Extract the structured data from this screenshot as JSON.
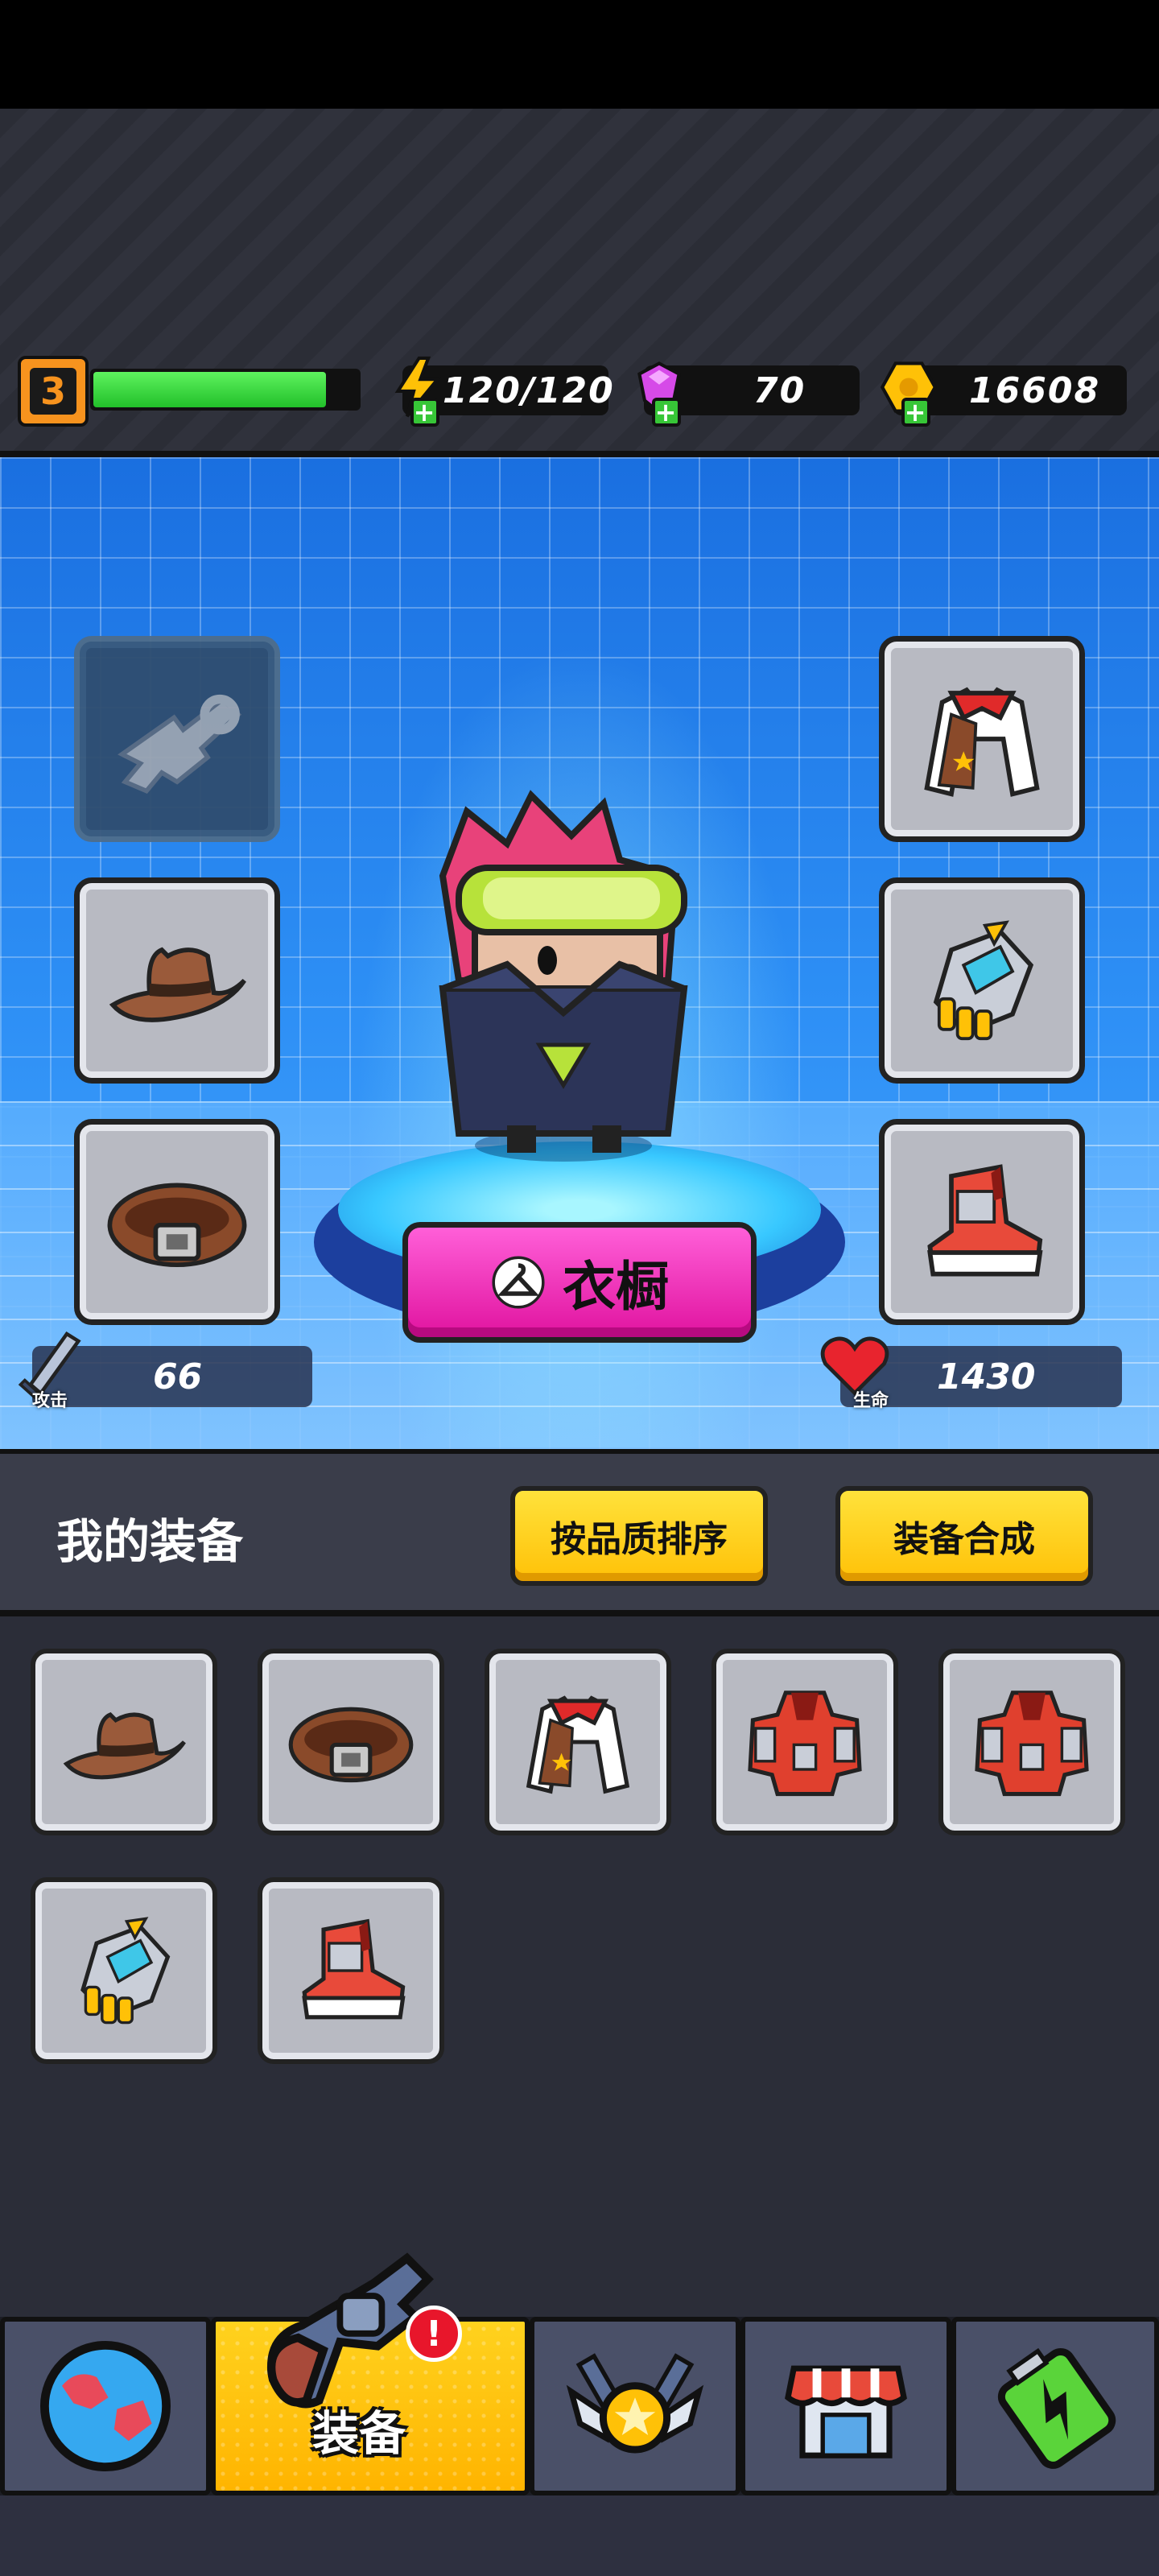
{
  "hud": {
    "level": "3",
    "xp_progress": 0.88,
    "energy": "120/120",
    "gems": "70",
    "coins": "16608"
  },
  "character_stage": {
    "wardrobe_label": "衣橱",
    "attack_label": "攻击",
    "attack_value": "66",
    "health_label": "生命",
    "health_value": "1430",
    "equipped": {
      "weapon": "gun-icon",
      "hat": "cowboy-hat-icon",
      "belt": "belt-icon",
      "armor": "vest-icon",
      "gloves": "gauntlet-icon",
      "shoes": "sneaker-icon"
    }
  },
  "equipment_section": {
    "title": "我的装备",
    "sort_button": "按品质排序",
    "merge_button": "装备合成"
  },
  "inventory": [
    {
      "item": "cowboy-hat-icon"
    },
    {
      "item": "belt-icon"
    },
    {
      "item": "vest-icon"
    },
    {
      "item": "red-armor-icon"
    },
    {
      "item": "red-armor-icon"
    },
    {
      "item": "gauntlet-icon"
    },
    {
      "item": "sneaker-icon"
    }
  ],
  "nav": {
    "items": [
      {
        "name": "world-icon"
      },
      {
        "name": "equipment",
        "label": "装备",
        "active": true,
        "alert": "!"
      },
      {
        "name": "talent-badge-icon"
      },
      {
        "name": "shop-icon"
      },
      {
        "name": "energy-battery-icon"
      }
    ]
  },
  "colors": {
    "accent_yellow": "#ffc107",
    "wardrobe_pink": "#e0139f",
    "xp_green": "#22c02a",
    "level_orange": "#f7931e"
  }
}
